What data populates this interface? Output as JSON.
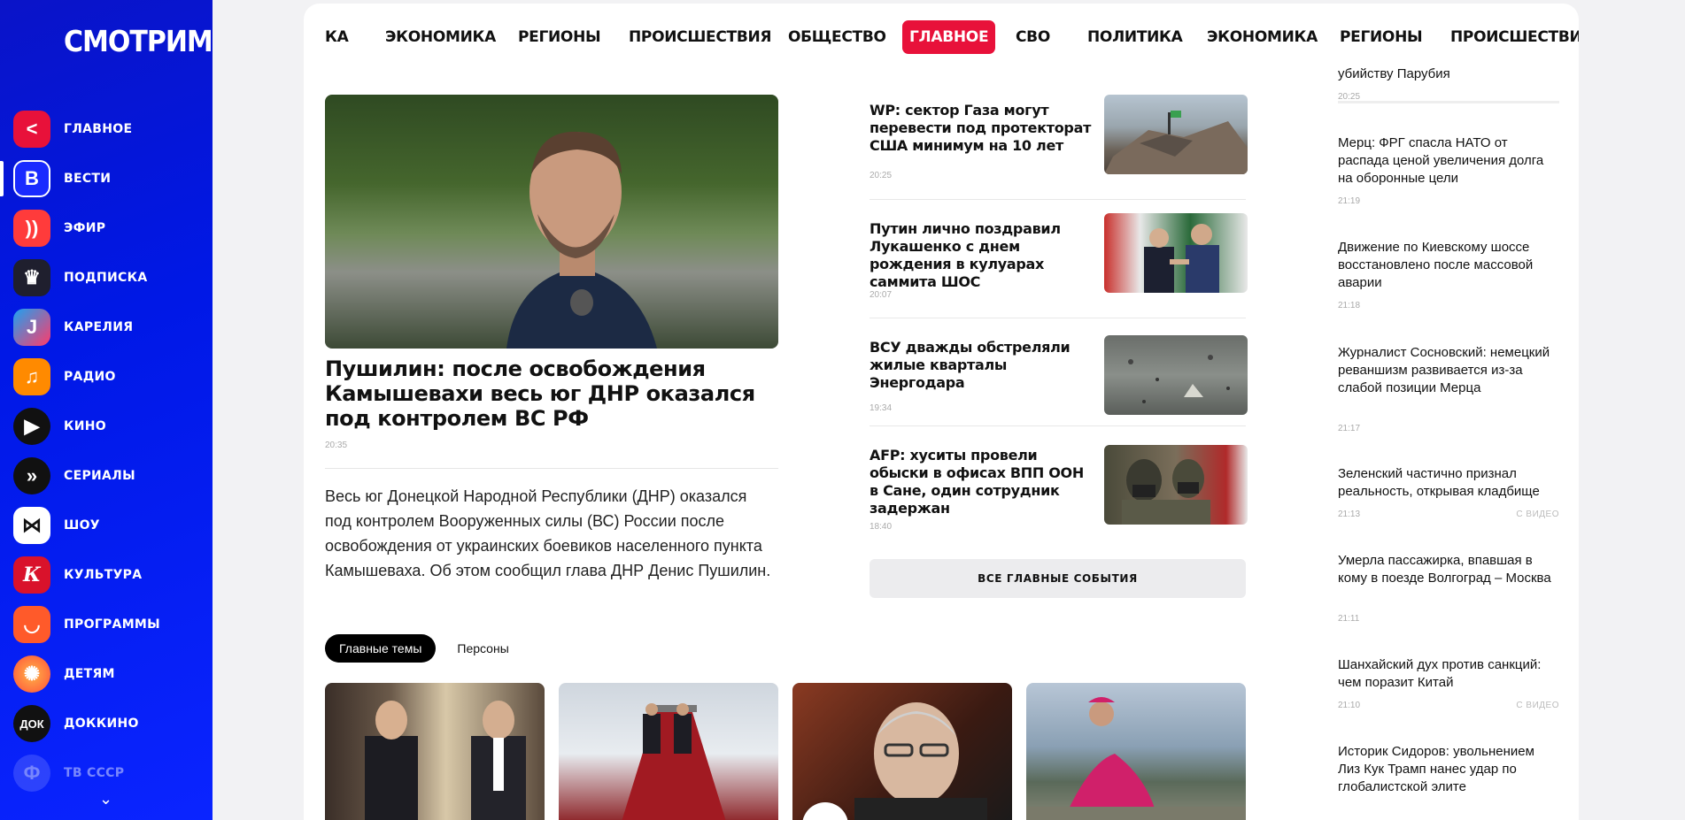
{
  "sidebar": {
    "logo": "СМОТРИМ",
    "items": [
      {
        "label": "ГЛАВНОЕ",
        "color": "#e8113a",
        "glyph": "<"
      },
      {
        "label": "ВЕСТИ",
        "color": "#1a2bff",
        "glyph": "В"
      },
      {
        "label": "ЭФИР",
        "color": "#ff3b3b",
        "glyph": "))"
      },
      {
        "label": "ПОДПИСКА",
        "color": "#1f1f2e",
        "glyph": "♛"
      },
      {
        "label": "КАРЕЛИЯ",
        "color": "#1da1f2",
        "glyph": "J"
      },
      {
        "label": "РАДИО",
        "color": "#ff8a00",
        "glyph": "♫"
      },
      {
        "label": "КИНО",
        "color": "#111111",
        "glyph": "▶"
      },
      {
        "label": "СЕРИАЛЫ",
        "color": "#111111",
        "glyph": "»"
      },
      {
        "label": "ШОУ",
        "color": "#ffffff",
        "glyph": "⋈"
      },
      {
        "label": "КУЛЬТУРА",
        "color": "#d9122b",
        "glyph": "К"
      },
      {
        "label": "ПРОГРАММЫ",
        "color": "#ff5a2a",
        "glyph": "◡"
      },
      {
        "label": "ДЕТЯМ",
        "color": "#ff4f3a",
        "glyph": "✺"
      },
      {
        "label": "ДОККИНО",
        "color": "#111111",
        "glyph": "ДОК"
      },
      {
        "label": "ТВ СССР",
        "color": "#b8c0ff",
        "glyph": "Ф"
      }
    ]
  },
  "topnav": {
    "items": [
      "КА",
      "ЭКОНОМИКА",
      "РЕГИОНЫ",
      "ПРОИСШЕСТВИЯ",
      "ОБЩЕСТВО",
      "ГЛАВНОЕ",
      "СВО",
      "ПОЛИТИКА",
      "ЭКОНОМИКА",
      "РЕГИОНЫ",
      "ПРОИСШЕСТВИ"
    ],
    "active_index": 5,
    "accent": "#e8113a"
  },
  "lead": {
    "title": "Пушилин: после освобождения Камышевахи весь юг ДНР оказался под контролем ВС РФ",
    "time": "20:35",
    "description": "Весь юг Донецкой Народной Республики (ДНР) оказался под контролем Вооруженных силы (ВС) России после освобождения от украинских боевиков населенного пункта Камышеваха. Об этом сообщил глава ДНР Денис Пушилин."
  },
  "tabs": [
    "Главные темы",
    "Персоны"
  ],
  "main_news": [
    {
      "title": "WP: сектор Газа могут перевести под протекторат США минимум на 10 лет",
      "time": "20:25"
    },
    {
      "title": "Путин лично поздравил Лукашенко с днем рождения в кулуарах саммита ШОС",
      "time": "20:07"
    },
    {
      "title": "ВСУ дважды обстреляли жилые кварталы Энергодара",
      "time": "19:34"
    },
    {
      "title": "AFP: хуситы провели обыски в офисах ВПП ООН в Сане, один сотрудник задержан",
      "time": "18:40"
    }
  ],
  "all_events_label": "ВСЕ ГЛАВНЫЕ СОБЫТИЯ",
  "feed": [
    {
      "title": "убийству Парубия",
      "time": "20:25",
      "video": ""
    },
    {
      "title": "Мерц: ФРГ спасла НАТО от распада ценой увеличения долга на оборонные цели",
      "time": "21:19",
      "video": ""
    },
    {
      "title": "Движение по Киевскому шоссе восстановлено после массовой аварии",
      "time": "21:18",
      "video": ""
    },
    {
      "title": "Журналист Сосновский: немецкий реваншизм развивается из-за слабой позиции Мерца",
      "time": "21:17",
      "video": ""
    },
    {
      "title": "Зеленский частично признал реальность, открывая кладбище",
      "time": "21:13",
      "video": "С ВИДЕО"
    },
    {
      "title": "Умерла пассажирка, впавшая в кому в поезде Волгоград – Москва",
      "time": "21:11",
      "video": ""
    },
    {
      "title": "Шанхайский дух против санкций: чем поразит Китай",
      "time": "21:10",
      "video": "С ВИДЕО"
    },
    {
      "title": "Историк Сидоров: увольнением Лиз Кук Трамп нанес удар по глобалистской элите",
      "time": "",
      "video": ""
    }
  ]
}
